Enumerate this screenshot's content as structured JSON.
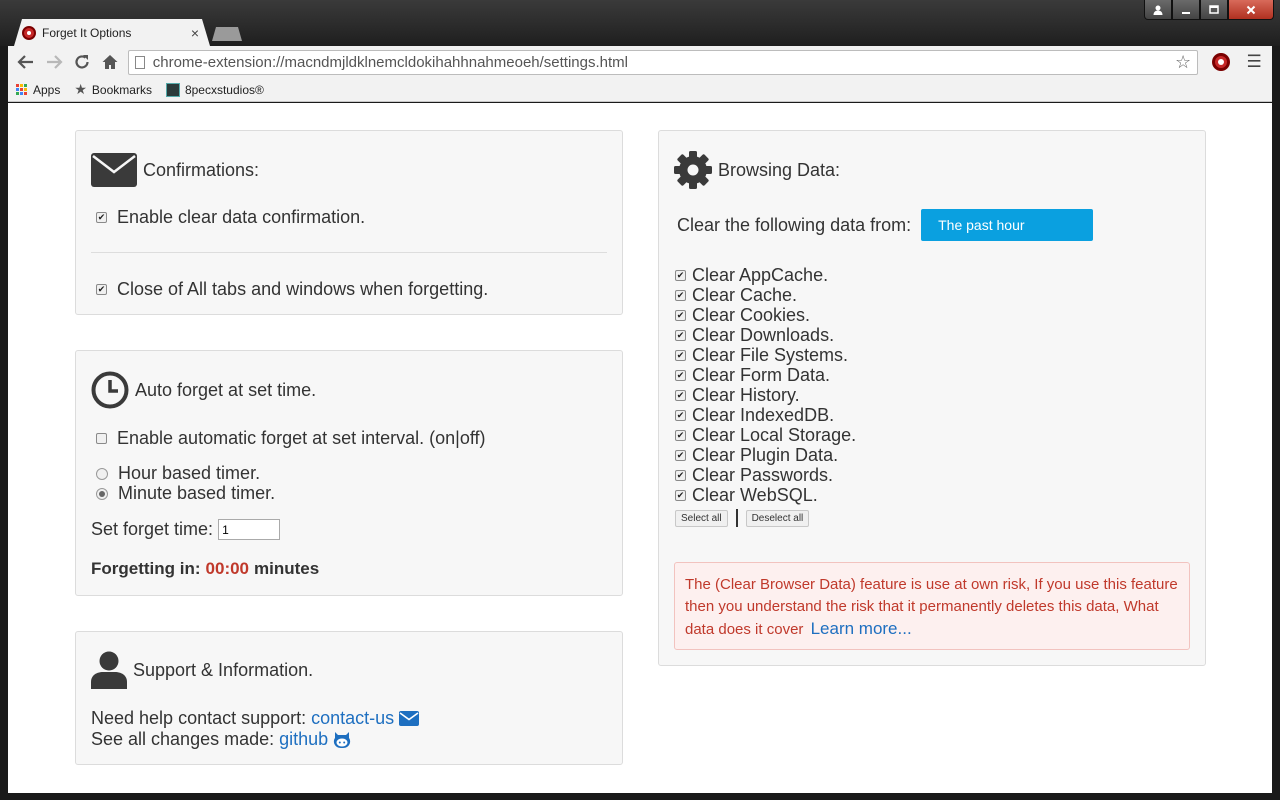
{
  "browser": {
    "tab_title": "Forget It Options",
    "tab_close": "×",
    "url": "chrome-extension://macndmjldklnemcldokihahhnahmeoeh/settings.html",
    "bookmarks": [
      {
        "label": "Apps"
      },
      {
        "label": "Bookmarks"
      },
      {
        "label": "8pecxstudios®"
      }
    ]
  },
  "confirmations": {
    "title": "Confirmations:",
    "items": [
      {
        "label": "Enable clear data confirmation.",
        "checked": true
      },
      {
        "label": "Close of All tabs and windows when forgetting.",
        "checked": true
      }
    ]
  },
  "auto_forget": {
    "title": "Auto forget at set time.",
    "enable_label": "Enable automatic forget at set interval. (on|off)",
    "enable_checked": false,
    "timers": [
      {
        "label": "Hour based timer.",
        "selected": false
      },
      {
        "label": "Minute based timer.",
        "selected": true
      }
    ],
    "set_time_label": "Set forget time:",
    "set_time_value": "1",
    "forgetting_prefix": "Forgetting in:",
    "countdown": "00:00",
    "forgetting_suffix": "minutes"
  },
  "support": {
    "title": "Support & Information.",
    "help_text": "Need help contact support:",
    "contact_link": "contact-us",
    "changes_text": "See all changes made:",
    "github_link": "github"
  },
  "browsing_data": {
    "title": "Browsing Data:",
    "clear_from_label": "Clear the following data from:",
    "time_range": "The past hour",
    "items": [
      {
        "label": "Clear AppCache.",
        "checked": true
      },
      {
        "label": "Clear Cache.",
        "checked": true
      },
      {
        "label": "Clear Cookies.",
        "checked": true
      },
      {
        "label": "Clear Downloads.",
        "checked": true
      },
      {
        "label": "Clear File Systems.",
        "checked": true
      },
      {
        "label": "Clear Form Data.",
        "checked": true
      },
      {
        "label": "Clear History.",
        "checked": true
      },
      {
        "label": "Clear IndexedDB.",
        "checked": true
      },
      {
        "label": "Clear Local Storage.",
        "checked": true
      },
      {
        "label": "Clear Plugin Data.",
        "checked": true
      },
      {
        "label": "Clear Passwords.",
        "checked": true
      },
      {
        "label": "Clear WebSQL.",
        "checked": true
      }
    ],
    "select_all": "Select all",
    "deselect_all": "Deselect all",
    "warning_text": "The (Clear Browser Data) feature is use at own risk, If you use this feature then you understand the risk that it permanently deletes this data, What data does it cover",
    "learn_more": "Learn more..."
  },
  "colors": {
    "accent": "#0aa0e0",
    "link": "#1e6fc0",
    "countdown": "#c0392b",
    "warning_text": "#c0392b",
    "warning_bg": "#fdf0ef"
  }
}
